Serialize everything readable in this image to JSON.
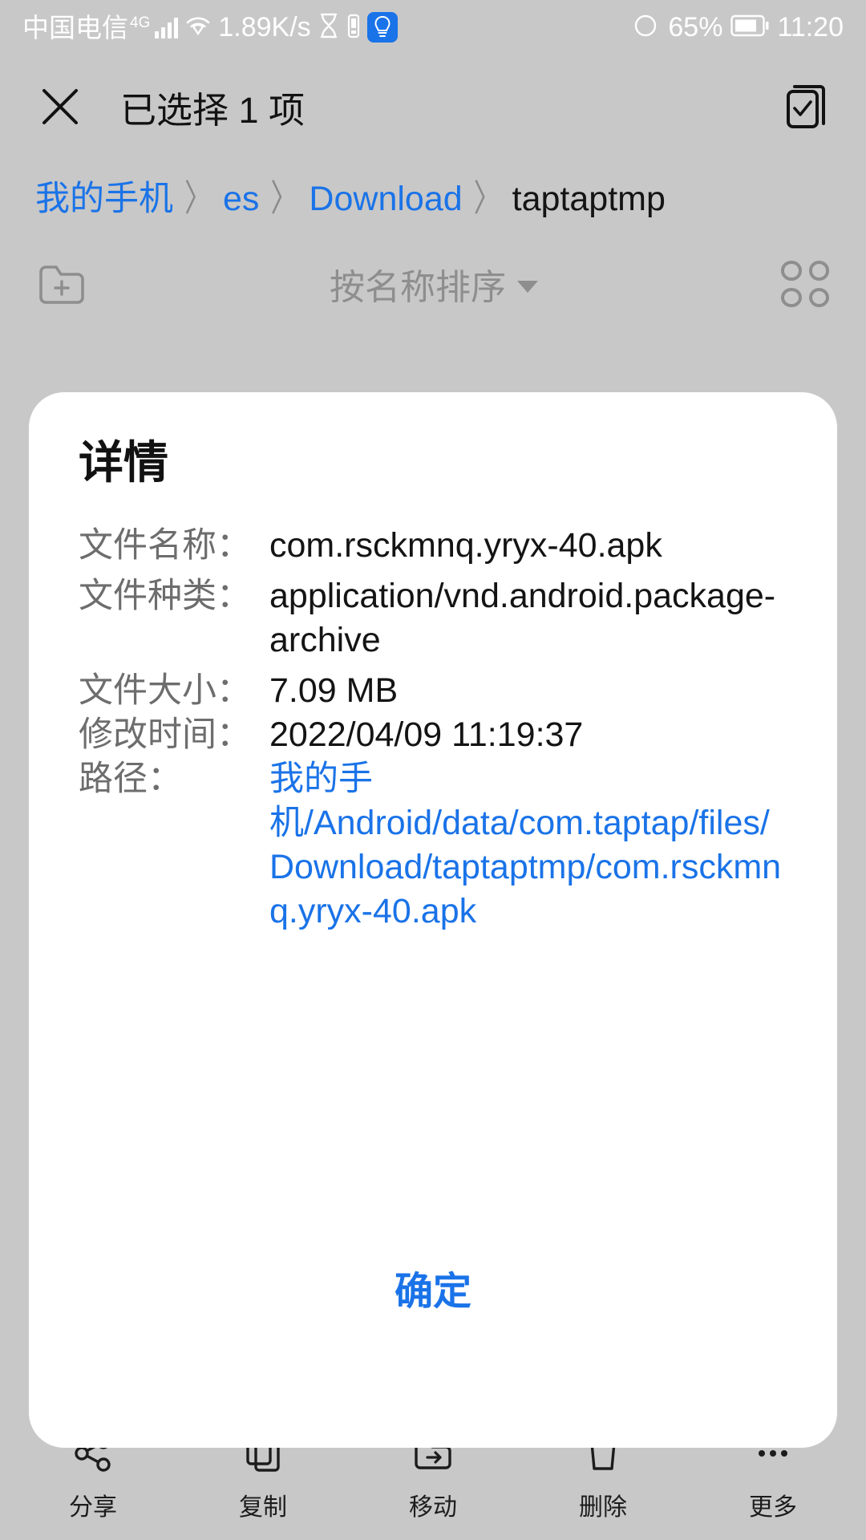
{
  "status_bar": {
    "carrier": "中国电信",
    "network_type": "4G",
    "net_speed": "1.89K/s",
    "battery_percent": "65%",
    "clock": "11:20",
    "icons": [
      "signal-bars-icon",
      "wifi-icon",
      "hourglass-icon",
      "battery-small-icon",
      "lightbulb-badge-icon",
      "eye-icon",
      "battery-icon"
    ],
    "accent": "#1a73e8"
  },
  "app_bar": {
    "close_label": "close-icon",
    "title": "已选择 1 项",
    "select_all_label": "select-all-icon"
  },
  "breadcrumb": {
    "items": [
      {
        "label": "我的手机",
        "last": false
      },
      {
        "label": "es",
        "last": false
      },
      {
        "label": "Download",
        "last": false
      },
      {
        "label": "taptaptmp",
        "last": true
      }
    ],
    "separator": "〉"
  },
  "toolbar": {
    "new_folder_label": "new-folder-icon",
    "sort_label": "按名称排序",
    "grid_view_label": "grid-view-icon"
  },
  "dialog": {
    "title": "详情",
    "rows": [
      {
        "label": "文件名称：",
        "value": "com.rsckmnq.yryx-40.apk",
        "link": false
      },
      {
        "label": "文件种类：",
        "value": "application/vnd.android.package-archive",
        "link": false
      },
      {
        "label": "文件大小：",
        "value": "7.09 MB",
        "link": false
      },
      {
        "label": "修改时间：",
        "value": "2022/04/09 11:19:37",
        "link": false
      },
      {
        "label": "路径：",
        "value": "我的手机/Android/data/com.taptap/files/Download/taptaptmp/com.rsckmnq.yryx-40.apk",
        "link": true
      }
    ],
    "ok_label": "确定"
  },
  "bottom_bar": {
    "items": [
      {
        "label": "分享",
        "icon": "share-icon"
      },
      {
        "label": "复制",
        "icon": "copy-icon"
      },
      {
        "label": "移动",
        "icon": "move-icon"
      },
      {
        "label": "删除",
        "icon": "delete-icon"
      },
      {
        "label": "更多",
        "icon": "more-icon"
      }
    ]
  }
}
